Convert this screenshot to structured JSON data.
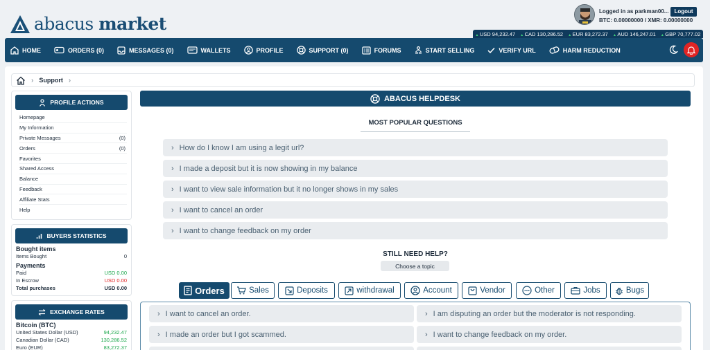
{
  "brand": {
    "word1": "abacus",
    "word2": "market"
  },
  "user": {
    "logged_in": "Logged in as parkman00...",
    "logout": "Logout",
    "balance": "BTC: 0.00000000 / XMR: 0.00000000"
  },
  "ticker": [
    "USD 94,232.47",
    "CAD 130,286.52",
    "EUR 83,272.37",
    "AUD 146,247.01",
    "GBP 70,777.02"
  ],
  "nav": {
    "home": "HOME",
    "orders": "ORDERS (0)",
    "messages": "MESSAGES (0)",
    "wallets": "WALLETS",
    "profile": "PROFILE",
    "support": "SUPPORT (0)",
    "forums": "FORUMS",
    "start_selling": "START SELLING",
    "verify_url": "VERIFY URL",
    "harm_reduction": "HARM REDUCTION"
  },
  "breadcrumb": {
    "current": "Support"
  },
  "profile_actions": {
    "title": "PROFILE ACTIONS",
    "items": [
      {
        "label": "Homepage",
        "count": ""
      },
      {
        "label": "My Information",
        "count": ""
      },
      {
        "label": "Private Messages",
        "count": "(0)"
      },
      {
        "label": "Orders",
        "count": "(0)"
      },
      {
        "label": "Favorites",
        "count": ""
      },
      {
        "label": "Shared Access",
        "count": ""
      },
      {
        "label": "Balance",
        "count": ""
      },
      {
        "label": "Feedback",
        "count": ""
      },
      {
        "label": "Affiliate Stats",
        "count": ""
      },
      {
        "label": "Help",
        "count": ""
      }
    ]
  },
  "buyers_stats": {
    "title": "BUYERS STATISTICS",
    "bought_heading": "Bought items",
    "items_bought_label": "Items Bought",
    "items_bought_value": "0",
    "payments_heading": "Payments",
    "paid_label": "Paid",
    "paid_value": "USD 0.00",
    "escrow_label": "In Escrow",
    "escrow_value": "USD 0.00",
    "total_label": "Total purchases",
    "total_value": "USD 0.00"
  },
  "exchange": {
    "title": "EXCHANGE RATES",
    "coin": "Bitcoin (BTC)",
    "rows": [
      {
        "label": "United States Dollar (USD)",
        "value": "94,232.47"
      },
      {
        "label": "Canadian Dollar (CAD)",
        "value": "130,286.52"
      },
      {
        "label": "Euro (EUR)",
        "value": "83,272.37"
      }
    ]
  },
  "helpdesk": {
    "title": "ABACUS HELPDESK",
    "popular_title": "MOST POPULAR QUESTIONS",
    "popular": [
      "How do I know I am using a legit url?",
      "I made a deposit but it is now showing in my balance",
      "I want to view sale information but it no longer shows in my sales",
      "I want to cancel an order",
      "I want to change feedback on my order"
    ],
    "still_need": "STILL NEED HELP?",
    "choose_topic": "Choose a topic",
    "tabs": [
      "Orders",
      "Sales",
      "Deposits",
      "withdrawal",
      "Account",
      "Vendor",
      "Other",
      "Jobs",
      "Bugs"
    ],
    "orders_questions": [
      "I want to cancel an order.",
      "I am disputing an order but the moderator is not responding.",
      "I made an order but I got scammed.",
      "I want to change feedback on my order."
    ]
  }
}
